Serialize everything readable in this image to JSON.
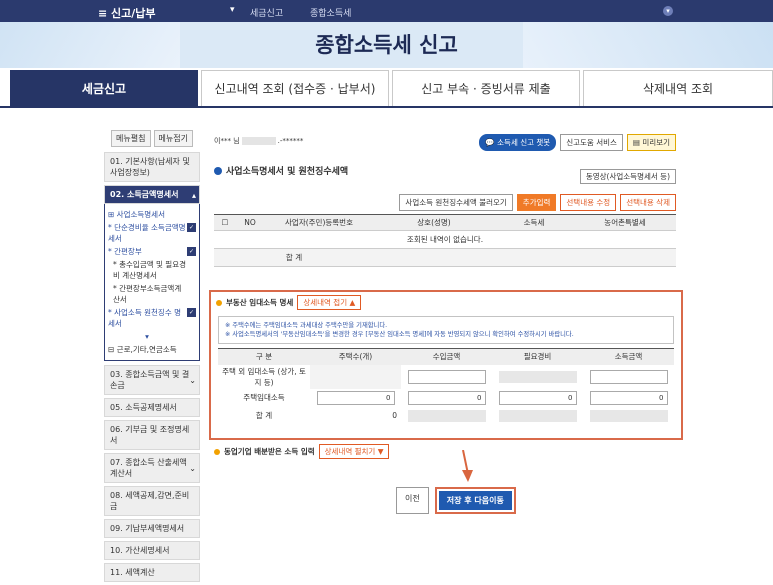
{
  "topbar": {
    "menu": "신고/납부",
    "crumb1": "세금신고",
    "crumb2": "종합소득세"
  },
  "page_title": "종합소득세 신고",
  "tabs": [
    "세금신고",
    "신고내역 조회 (접수증 · 납부서)",
    "신고 부속 · 증빙서류 제출",
    "삭제내역 조회"
  ],
  "sidebar": {
    "edit": "메뉴펼침",
    "collapse": "메뉴접기",
    "s1": "01. 기본사항(납세자 및 사업장정보)",
    "s2": "02. 소득금액명세서",
    "sub": [
      "⊞ 사업소득명세서",
      "* 단순경비율 소득금액명세서",
      "* 간편장부",
      "* 총수입금액 및 필요경비 계산명세서",
      "* 간편장부소득금액계산서",
      "* 사업소득 원천징수 명세서",
      "⊟ 근로,기타,연금소득"
    ],
    "s3": "03. 종합소득금액 및 결손금",
    "s5": "05. 소득공제명세서",
    "s6": "06. 기부금 및 조정명세서",
    "s7": "07. 종합소득 산출세액계산서",
    "s8": "08. 세액공제,감면,준비금",
    "s9": "09. 기납부세액명세서",
    "s10": "10. 가산세명세서",
    "s11": "11. 세액계산"
  },
  "main": {
    "user_prefix": "이*** 님",
    "user_suffix": ".-******",
    "chatbot": "소득세 신고 챗봇",
    "help": "신고도움 서비스",
    "preview": "미리보기",
    "section1": "사업소득명세서 및 원천징수세액",
    "video": "동영상(사업소득명세서 등)",
    "btn_load": "사업소득 원천징수세액 불러오기",
    "btn_add": "추가입력",
    "btn_edit": "선택내용 수정",
    "btn_del": "선택내용 삭제",
    "t1_headers": [
      "NO",
      "사업자(주민)등록번호",
      "상호(성명)",
      "소득세",
      "농어촌특별세"
    ],
    "t1_empty": "조회된 내역이 없습니다.",
    "t1_sum": "합 계"
  },
  "panel": {
    "title": "부동산 임대소득 명세",
    "toggle": "상세내역 접기 ▲",
    "note1": "※ 주택수에는 주택임대소득 과세대상 주택수만을 기재합니다.",
    "note2": "※ 사업소득명세서의 '부동산임대소득'을 변경한 경우 [부동산 임대소득 명세]에 자동 반영되지 않으니 확인하여 수정하시기 바랍니다.",
    "headers": [
      "구 분",
      "주택수(개)",
      "수입금액",
      "필요경비",
      "소득금액"
    ],
    "row1": "주택 외 임대소득 (상가, 토지 등)",
    "row2": "주택임대소득",
    "row3": "합 계",
    "v_count": "0",
    "v_income": "0",
    "v_expense": "0",
    "v_total": "0",
    "v_sum": "0"
  },
  "section3": {
    "title": "동업기업 배분받은 소득 입력",
    "toggle": "상세내역 펼치기 ▼"
  },
  "footer": {
    "prev": "이전",
    "next": "저장 후 다음이동"
  }
}
